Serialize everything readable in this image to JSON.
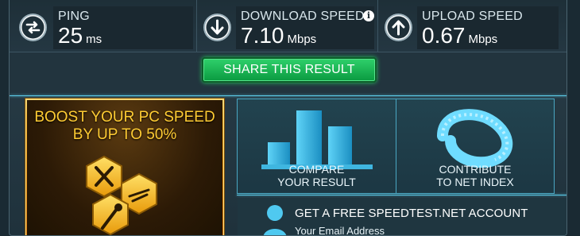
{
  "stats": {
    "ping": {
      "label": "PING",
      "value": "25",
      "unit": "ms",
      "icon": "swap-arrows-icon"
    },
    "download": {
      "label": "DOWNLOAD SPEED",
      "value": "7.10",
      "unit": "Mbps",
      "icon": "arrow-down-icon",
      "info": "i"
    },
    "upload": {
      "label": "UPLOAD SPEED",
      "value": "0.67",
      "unit": "Mbps",
      "icon": "arrow-up-icon"
    }
  },
  "share": {
    "label": "SHARE THIS RESULT"
  },
  "boost": {
    "title_line1": "BOOST YOUR PC SPEED",
    "title_line2": "BY UP TO 50%"
  },
  "tiles": {
    "compare": {
      "line1": "COMPARE",
      "line2": "YOUR RESULT",
      "icon": "bar-chart-icon"
    },
    "contribute": {
      "line1": "CONTRIBUTE",
      "line2": "TO NET INDEX",
      "icon": "ribbon-loop-icon"
    }
  },
  "account": {
    "title": "GET A FREE SPEEDTEST.NET ACCOUNT",
    "email_placeholder": "Your Email Address"
  },
  "colors": {
    "accent_green": "#1fb856",
    "boost_gold": "#f4b02a",
    "tile_border": "#4aa7c3"
  }
}
